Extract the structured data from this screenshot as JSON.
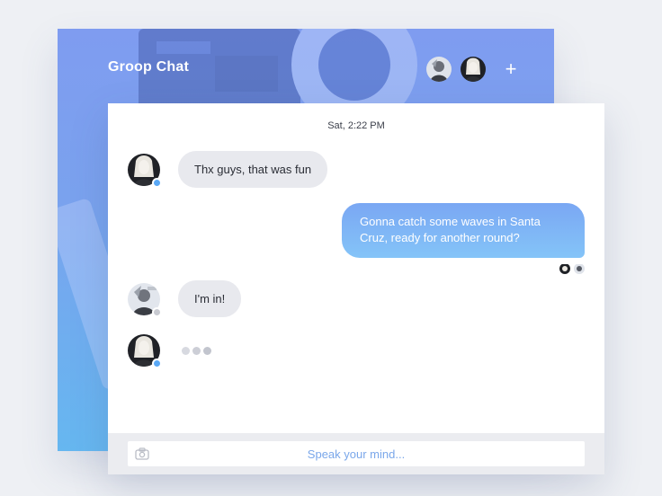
{
  "header": {
    "title": "Groop Chat",
    "members": [
      "member-1",
      "member-2"
    ],
    "add_icon": "plus-icon",
    "add_glyph": "+"
  },
  "chat": {
    "timestamp": "Sat, 2:22 PM",
    "messages": [
      {
        "from": "member-blonde",
        "status": "online",
        "text": "Thx guys, that was fun"
      },
      {
        "from": "me",
        "text": "Gonna catch some waves in Santa Cruz, ready for another round?"
      },
      {
        "from": "member-surfer",
        "status": "offline",
        "text": "I'm in!"
      },
      {
        "from": "member-blonde",
        "status": "online",
        "typing": true
      }
    ]
  },
  "composer": {
    "placeholder": "Speak your mind...",
    "camera_icon": "camera-icon"
  },
  "colors": {
    "accent_blue": "#7aa7f3",
    "online": "#5aa8f5",
    "offline": "#c8cad1",
    "bubble_in": "#e8e9ee"
  }
}
